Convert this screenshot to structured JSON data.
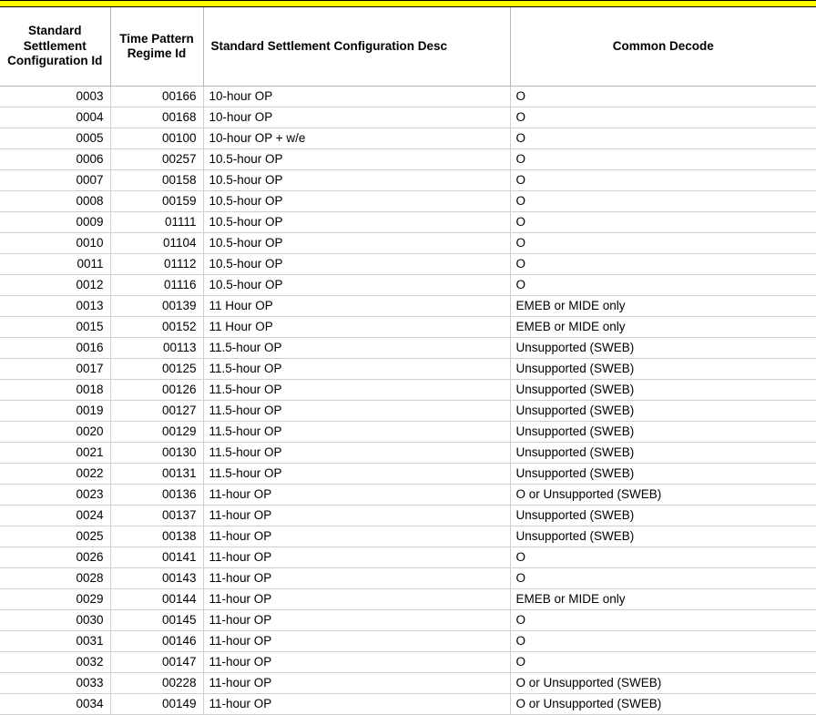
{
  "banner": {
    "color": "#ffff00"
  },
  "table": {
    "columns": [
      {
        "key": "ssc_id",
        "label": "Standard Settlement Configuration Id",
        "align": "center"
      },
      {
        "key": "tpr_id",
        "label": "Time Pattern Regime Id",
        "align": "center"
      },
      {
        "key": "ssc_desc",
        "label": "Standard Settlement Configuration Desc",
        "align": "left"
      },
      {
        "key": "decode",
        "label": "Common Decode",
        "align": "center"
      }
    ],
    "rows": [
      {
        "ssc_id": "0003",
        "tpr_id": "00166",
        "ssc_desc": "10-hour OP",
        "decode": "O"
      },
      {
        "ssc_id": "0004",
        "tpr_id": "00168",
        "ssc_desc": "10-hour OP",
        "decode": "O"
      },
      {
        "ssc_id": "0005",
        "tpr_id": "00100",
        "ssc_desc": "10-hour OP + w/e",
        "decode": "O"
      },
      {
        "ssc_id": "0006",
        "tpr_id": "00257",
        "ssc_desc": "10.5-hour OP",
        "decode": "O"
      },
      {
        "ssc_id": "0007",
        "tpr_id": "00158",
        "ssc_desc": "10.5-hour OP",
        "decode": "O"
      },
      {
        "ssc_id": "0008",
        "tpr_id": "00159",
        "ssc_desc": "10.5-hour OP",
        "decode": "O"
      },
      {
        "ssc_id": "0009",
        "tpr_id": "01111",
        "ssc_desc": "10.5-hour OP",
        "decode": "O"
      },
      {
        "ssc_id": "0010",
        "tpr_id": "01104",
        "ssc_desc": "10.5-hour OP",
        "decode": "O"
      },
      {
        "ssc_id": "0011",
        "tpr_id": "01112",
        "ssc_desc": "10.5-hour OP",
        "decode": "O"
      },
      {
        "ssc_id": "0012",
        "tpr_id": "01116",
        "ssc_desc": "10.5-hour OP",
        "decode": "O"
      },
      {
        "ssc_id": "0013",
        "tpr_id": "00139",
        "ssc_desc": "11 Hour OP",
        "decode": "EMEB or MIDE only"
      },
      {
        "ssc_id": "0015",
        "tpr_id": "00152",
        "ssc_desc": "11 Hour OP",
        "decode": "EMEB or MIDE only"
      },
      {
        "ssc_id": "0016",
        "tpr_id": "00113",
        "ssc_desc": "11.5-hour OP",
        "decode": "Unsupported (SWEB)"
      },
      {
        "ssc_id": "0017",
        "tpr_id": "00125",
        "ssc_desc": "11.5-hour OP",
        "decode": "Unsupported (SWEB)"
      },
      {
        "ssc_id": "0018",
        "tpr_id": "00126",
        "ssc_desc": "11.5-hour OP",
        "decode": "Unsupported (SWEB)"
      },
      {
        "ssc_id": "0019",
        "tpr_id": "00127",
        "ssc_desc": "11.5-hour OP",
        "decode": "Unsupported (SWEB)"
      },
      {
        "ssc_id": "0020",
        "tpr_id": "00129",
        "ssc_desc": "11.5-hour OP",
        "decode": "Unsupported (SWEB)"
      },
      {
        "ssc_id": "0021",
        "tpr_id": "00130",
        "ssc_desc": "11.5-hour OP",
        "decode": "Unsupported (SWEB)"
      },
      {
        "ssc_id": "0022",
        "tpr_id": "00131",
        "ssc_desc": "11.5-hour OP",
        "decode": "Unsupported (SWEB)"
      },
      {
        "ssc_id": "0023",
        "tpr_id": "00136",
        "ssc_desc": "11-hour OP",
        "decode": "O or Unsupported (SWEB)"
      },
      {
        "ssc_id": "0024",
        "tpr_id": "00137",
        "ssc_desc": "11-hour OP",
        "decode": "Unsupported (SWEB)"
      },
      {
        "ssc_id": "0025",
        "tpr_id": "00138",
        "ssc_desc": "11-hour OP",
        "decode": "Unsupported (SWEB)"
      },
      {
        "ssc_id": "0026",
        "tpr_id": "00141",
        "ssc_desc": "11-hour OP",
        "decode": "O"
      },
      {
        "ssc_id": "0028",
        "tpr_id": "00143",
        "ssc_desc": "11-hour OP",
        "decode": "O"
      },
      {
        "ssc_id": "0029",
        "tpr_id": "00144",
        "ssc_desc": "11-hour OP",
        "decode": "EMEB or MIDE only"
      },
      {
        "ssc_id": "0030",
        "tpr_id": "00145",
        "ssc_desc": "11-hour OP",
        "decode": "O"
      },
      {
        "ssc_id": "0031",
        "tpr_id": "00146",
        "ssc_desc": "11-hour OP",
        "decode": "O"
      },
      {
        "ssc_id": "0032",
        "tpr_id": "00147",
        "ssc_desc": "11-hour OP",
        "decode": "O"
      },
      {
        "ssc_id": "0033",
        "tpr_id": "00228",
        "ssc_desc": "11-hour OP",
        "decode": "O or Unsupported (SWEB)"
      },
      {
        "ssc_id": "0034",
        "tpr_id": "00149",
        "ssc_desc": "11-hour OP",
        "decode": "O or Unsupported (SWEB)"
      }
    ]
  }
}
